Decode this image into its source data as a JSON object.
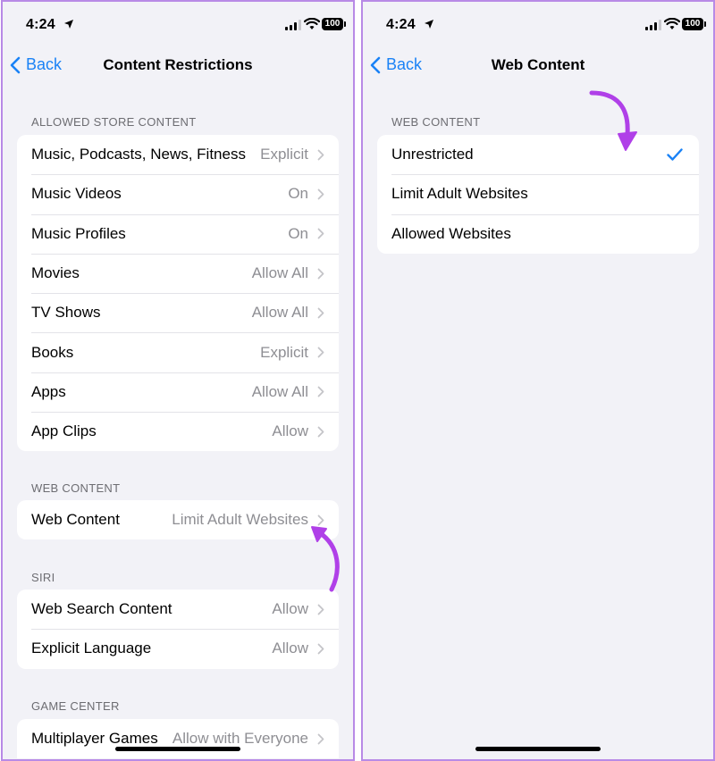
{
  "left": {
    "status": {
      "time": "4:24",
      "battery": "100"
    },
    "nav": {
      "back_label": "Back",
      "title": "Content Restrictions"
    },
    "sections": [
      {
        "header": "ALLOWED STORE CONTENT",
        "rows": [
          {
            "label": "Music, Podcasts, News, Fitness",
            "value": "Explicit"
          },
          {
            "label": "Music Videos",
            "value": "On"
          },
          {
            "label": "Music Profiles",
            "value": "On"
          },
          {
            "label": "Movies",
            "value": "Allow All"
          },
          {
            "label": "TV Shows",
            "value": "Allow All"
          },
          {
            "label": "Books",
            "value": "Explicit"
          },
          {
            "label": "Apps",
            "value": "Allow All"
          },
          {
            "label": "App Clips",
            "value": "Allow"
          }
        ]
      },
      {
        "header": "WEB CONTENT",
        "rows": [
          {
            "label": "Web Content",
            "value": "Limit Adult Websites"
          }
        ]
      },
      {
        "header": "SIRI",
        "rows": [
          {
            "label": "Web Search Content",
            "value": "Allow"
          },
          {
            "label": "Explicit Language",
            "value": "Allow"
          }
        ]
      },
      {
        "header": "GAME CENTER",
        "rows": [
          {
            "label": "Multiplayer Games",
            "value": "Allow with Everyone"
          }
        ]
      }
    ]
  },
  "right": {
    "status": {
      "time": "4:24",
      "battery": "100"
    },
    "nav": {
      "back_label": "Back",
      "title": "Web Content"
    },
    "section": {
      "header": "WEB CONTENT",
      "options": [
        {
          "label": "Unrestricted",
          "selected": true
        },
        {
          "label": "Limit Adult Websites",
          "selected": false
        },
        {
          "label": "Allowed Websites",
          "selected": false
        }
      ]
    }
  },
  "colors": {
    "accent": "#1a82f6",
    "annotation_arrow": "#b040e8",
    "panel_border": "#b88ae6",
    "background": "#f2f2f7"
  }
}
